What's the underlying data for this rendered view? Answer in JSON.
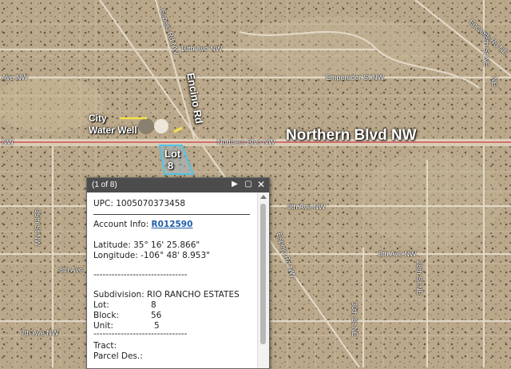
{
  "map": {
    "roads": {
      "tenth_ave": "10th Ave NW",
      "emperador_left": "Ave NW",
      "emperador": "Emperador St NW",
      "encino": "Encino Rd",
      "northern_left": "NW",
      "northern_small": "Northern Blvd NW",
      "northern_big": "Northern Blvd NW",
      "ninth_ave_left": "9th Ave NW",
      "ninth_ave": "9th Ave NW",
      "eighth_ave_left": "8th Ave",
      "eighth_ave": "8th Ave NW",
      "seventh_ave": "7th Ave NW",
      "thirty_fifth": "35th St NW",
      "expejo_top": "Espejo Rd NW",
      "espejo_mid": "Espejo Rd NW",
      "encanto": "Encanto Rd NE",
      "twenty_eighth_top": "28th St NE",
      "twenty_eighth_mid": "28th St NE",
      "thirtieth": "30th St NE",
      "right_ne": "NE"
    },
    "annotations": {
      "water_well_line1": "City",
      "water_well_line2": "Water Well",
      "lot_line1": "Lot",
      "lot_line2": "8"
    },
    "colors": {
      "parcel_outline": "#4fc3e8",
      "arrow_fill": "#f2c21b",
      "arrow_stroke": "#c0282c",
      "well_marker": "#f3e24a",
      "northern_road": "#d65050"
    }
  },
  "popup": {
    "count": "(1 of 8)",
    "icons": [
      "play-icon",
      "maximize-icon",
      "close-icon"
    ],
    "upc_label": "UPC:",
    "upc_value": "1005070373458",
    "account_label": "Account Info:",
    "account_value": "R012590",
    "lat_label": "Latitude:",
    "lat_value": "35° 16' 25.866\"",
    "lon_label": "Longitude:",
    "lon_value": "-106° 48' 8.953\"",
    "separator1": "-------------------------------",
    "subdivision_label": "Subdivision:",
    "subdivision_value": "RIO RANCHO ESTATES",
    "lot_label": "Lot:",
    "lot_value": "8",
    "block_label": "Block:",
    "block_value": "56",
    "unit_label": "Unit:",
    "unit_value": "5",
    "separator2": "-------------------------------",
    "tract_label": "Tract:",
    "parcel_label": "Parcel Des.:"
  }
}
